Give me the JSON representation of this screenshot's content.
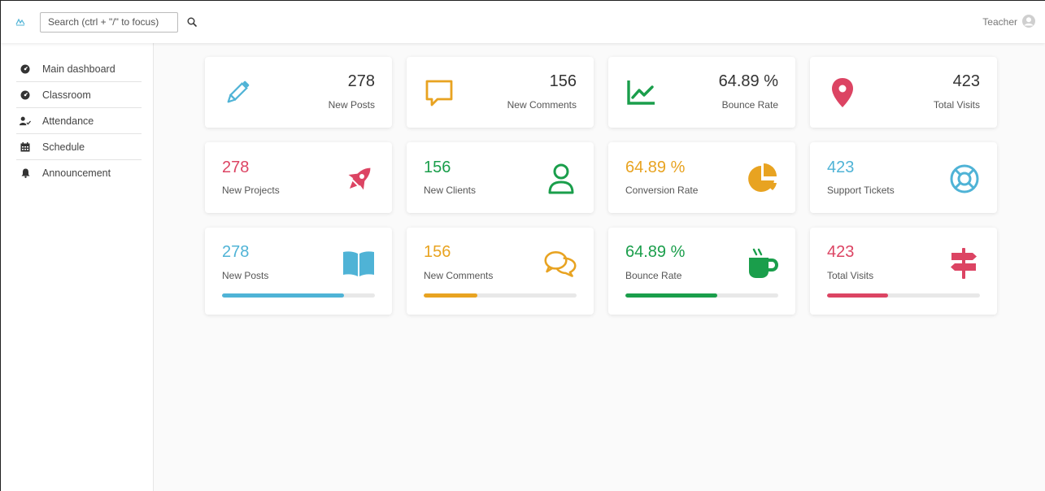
{
  "header": {
    "search_placeholder": "Search (ctrl + \"/\" to focus)",
    "user_name": "Teacher"
  },
  "sidebar": {
    "items": [
      {
        "label": "Main dashboard",
        "icon": "dashboard-icon"
      },
      {
        "label": "Classroom",
        "icon": "dashboard-icon"
      },
      {
        "label": "Attendance",
        "icon": "user-check-icon"
      },
      {
        "label": "Schedule",
        "icon": "calendar-icon"
      },
      {
        "label": "Announcement",
        "icon": "bell-icon"
      }
    ]
  },
  "colors": {
    "blue": "#4fb3d6",
    "orange": "#e8a321",
    "green": "#1a9e4b",
    "red": "#dc4463"
  },
  "cards_row1": [
    {
      "value": "278",
      "label": "New Posts",
      "icon": "pencil-icon",
      "color": "#4fb3d6"
    },
    {
      "value": "156",
      "label": "New Comments",
      "icon": "comment-icon",
      "color": "#e8a321"
    },
    {
      "value": "64.89 %",
      "label": "Bounce Rate",
      "icon": "line-chart-icon",
      "color": "#1a9e4b"
    },
    {
      "value": "423",
      "label": "Total Visits",
      "icon": "map-marker-icon",
      "color": "#dc4463"
    }
  ],
  "cards_row2": [
    {
      "value": "278",
      "label": "New Projects",
      "icon": "rocket-icon",
      "color": "#dc4463"
    },
    {
      "value": "156",
      "label": "New Clients",
      "icon": "user-icon",
      "color": "#1a9e4b"
    },
    {
      "value": "64.89 %",
      "label": "Conversion Rate",
      "icon": "pie-chart-icon",
      "color": "#e8a321"
    },
    {
      "value": "423",
      "label": "Support Tickets",
      "icon": "life-ring-icon",
      "color": "#4fb3d6"
    }
  ],
  "cards_row3": [
    {
      "value": "278",
      "label": "New Posts",
      "icon": "book-icon",
      "color": "#4fb3d6",
      "progress": 0.8
    },
    {
      "value": "156",
      "label": "New Comments",
      "icon": "comments-icon",
      "color": "#e8a321",
      "progress": 0.35
    },
    {
      "value": "64.89 %",
      "label": "Bounce Rate",
      "icon": "coffee-icon",
      "color": "#1a9e4b",
      "progress": 0.6
    },
    {
      "value": "423",
      "label": "Total Visits",
      "icon": "signpost-icon",
      "color": "#dc4463",
      "progress": 0.4
    }
  ]
}
